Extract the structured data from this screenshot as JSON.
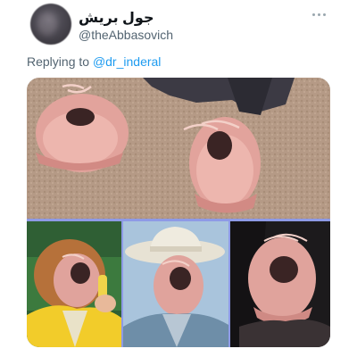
{
  "tweet": {
    "display_name": "جول بريش",
    "handle": "@theAbbasovich",
    "reply_prefix": "Replying to",
    "reply_to": "@dr_inderal",
    "more_icon": "more-dots-icon"
  },
  "media": {
    "count": 4,
    "images": [
      {
        "name": "shoes-on-carpet-image"
      },
      {
        "name": "laughing-girl-shoe-face-image"
      },
      {
        "name": "cowboy-shoe-face-image"
      },
      {
        "name": "man-shoe-face-image"
      }
    ]
  },
  "colors": {
    "link": "#1d9bf0",
    "secondary_text": "#536471",
    "primary_text": "#0f1419",
    "divider": "#8e9ae6"
  }
}
